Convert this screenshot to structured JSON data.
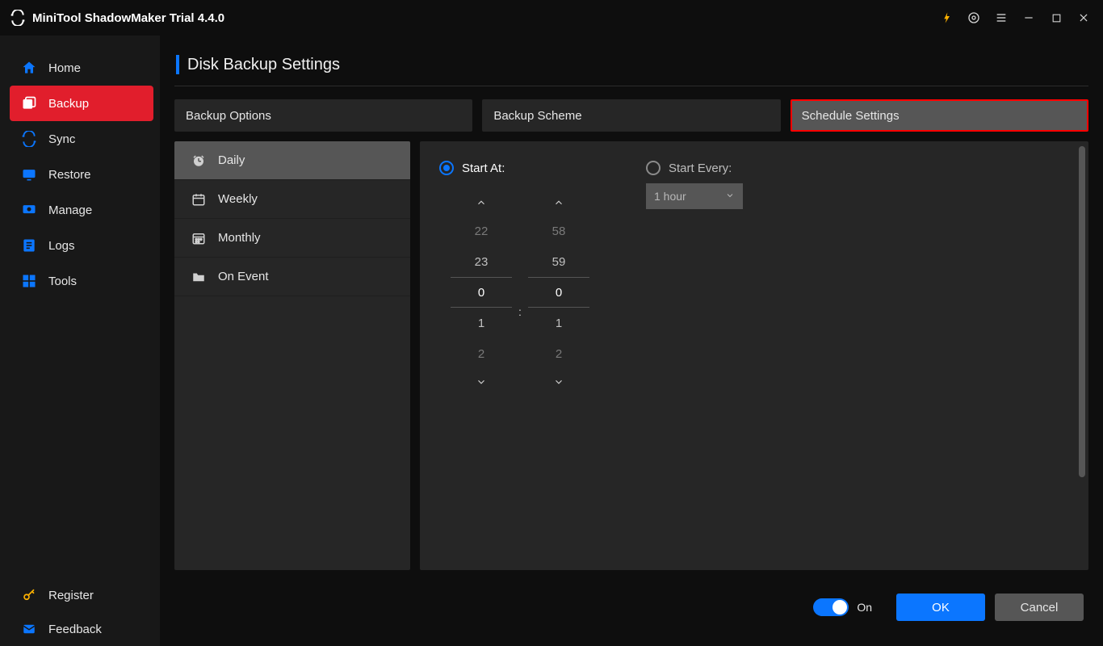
{
  "app": {
    "title": "MiniTool ShadowMaker Trial 4.4.0"
  },
  "sidebar": {
    "items": [
      {
        "label": "Home"
      },
      {
        "label": "Backup"
      },
      {
        "label": "Sync"
      },
      {
        "label": "Restore"
      },
      {
        "label": "Manage"
      },
      {
        "label": "Logs"
      },
      {
        "label": "Tools"
      }
    ],
    "bottom": [
      {
        "label": "Register"
      },
      {
        "label": "Feedback"
      }
    ]
  },
  "page": {
    "title": "Disk Backup Settings"
  },
  "tabs": {
    "options": "Backup Options",
    "scheme": "Backup Scheme",
    "schedule": "Schedule Settings"
  },
  "freq": {
    "daily": "Daily",
    "weekly": "Weekly",
    "monthly": "Monthly",
    "onevent": "On Event"
  },
  "schedule": {
    "start_at_label": "Start At:",
    "start_every_label": "Start Every:",
    "every_value": "1 hour",
    "hour": {
      "vminus2": "22",
      "vminus1": "23",
      "selected": "0",
      "vplus1": "1",
      "vplus2": "2"
    },
    "sep": ":",
    "minute": {
      "vminus2": "58",
      "vminus1": "59",
      "selected": "0",
      "vplus1": "1",
      "vplus2": "2"
    }
  },
  "footer": {
    "toggle_label": "On",
    "ok": "OK",
    "cancel": "Cancel"
  }
}
